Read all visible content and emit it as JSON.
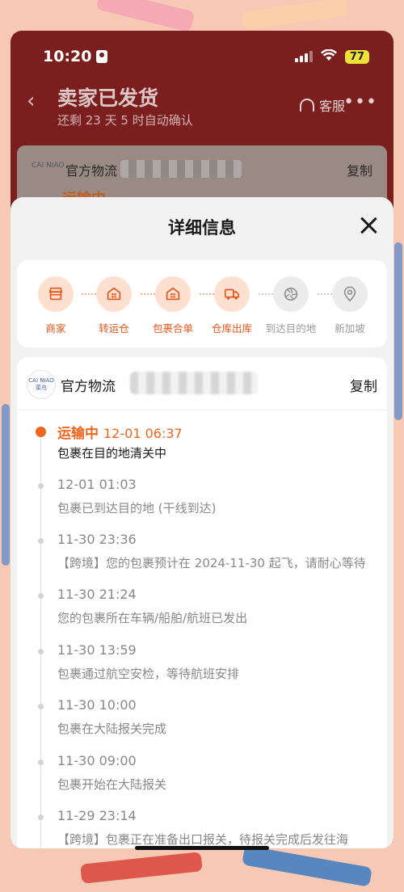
{
  "status_bar": {
    "time": "10:20",
    "battery": "77"
  },
  "nav": {
    "back_glyph": "‹",
    "title": "卖家已发货",
    "subtitle": "还剩 23 天 5 时自动确认",
    "service_label": "客服",
    "more_glyph": "•••"
  },
  "behind_card": {
    "logo_text": "CAI NIAO",
    "carrier": "官方物流",
    "copy": "复制",
    "status": "运输中"
  },
  "sheet": {
    "title": "详细信息",
    "close_icon": "close-icon"
  },
  "steps": [
    {
      "label": "商家",
      "icon": "store-icon",
      "state": "active"
    },
    {
      "label": "转运仓",
      "icon": "warehouse-icon",
      "state": "active"
    },
    {
      "label": "包裹合单",
      "icon": "warehouse-icon",
      "state": "active"
    },
    {
      "label": "仓库出库",
      "icon": "truck-icon",
      "state": "active"
    },
    {
      "label": "到达目的地",
      "icon": "aperture-icon",
      "state": "inactive"
    },
    {
      "label": "新加坡",
      "icon": "location-pin-icon",
      "state": "inactive"
    }
  ],
  "carrier": {
    "logo_text": "CAI NIAO 菜鸟",
    "name": "官方物流",
    "copy": "复制"
  },
  "timeline": [
    {
      "status": "运输中",
      "time": "12-01 06:37",
      "desc": "包裹在目的地清关中",
      "current": true
    },
    {
      "time": "12-01 01:03",
      "desc": "包裹已到达目的地 (干线到达)"
    },
    {
      "time": "11-30 23:36",
      "desc": "【跨境】您的包裹预计在 2024-11-30 起飞，请耐心等待"
    },
    {
      "time": "11-30 21:24",
      "desc": "您的包裹所在车辆/船舶/航班已发出"
    },
    {
      "time": "11-30 13:59",
      "desc": "包裹通过航空安检，等待航班安排"
    },
    {
      "time": "11-30 10:00",
      "desc": "包裹在大陆报关完成"
    },
    {
      "time": "11-30 09:00",
      "desc": "包裹开始在大陆报关"
    },
    {
      "time": "11-29 23:14",
      "desc": "【跨境】包裹正在准备出口报关，待报关完成后发往海"
    }
  ],
  "colors": {
    "accent": "#f0641e",
    "header_bg": "#7a1e1e",
    "sheet_bg": "#f2f2f2"
  }
}
